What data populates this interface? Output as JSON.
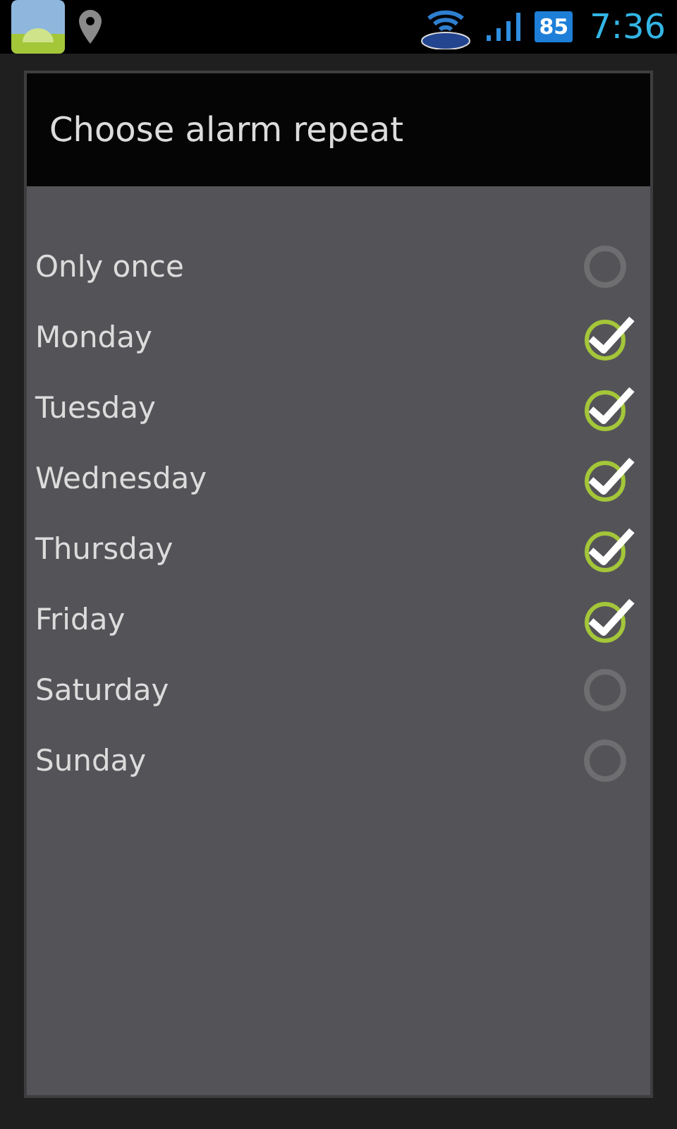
{
  "status_bar": {
    "battery": "85",
    "time": "7:36"
  },
  "dialog": {
    "title": "Choose alarm repeat",
    "options": [
      {
        "label": "Only once",
        "checked": false
      },
      {
        "label": "Monday",
        "checked": true
      },
      {
        "label": "Tuesday",
        "checked": true
      },
      {
        "label": "Wednesday",
        "checked": true
      },
      {
        "label": "Thursday",
        "checked": true
      },
      {
        "label": "Friday",
        "checked": true
      },
      {
        "label": "Saturday",
        "checked": false
      },
      {
        "label": "Sunday",
        "checked": false
      }
    ]
  }
}
